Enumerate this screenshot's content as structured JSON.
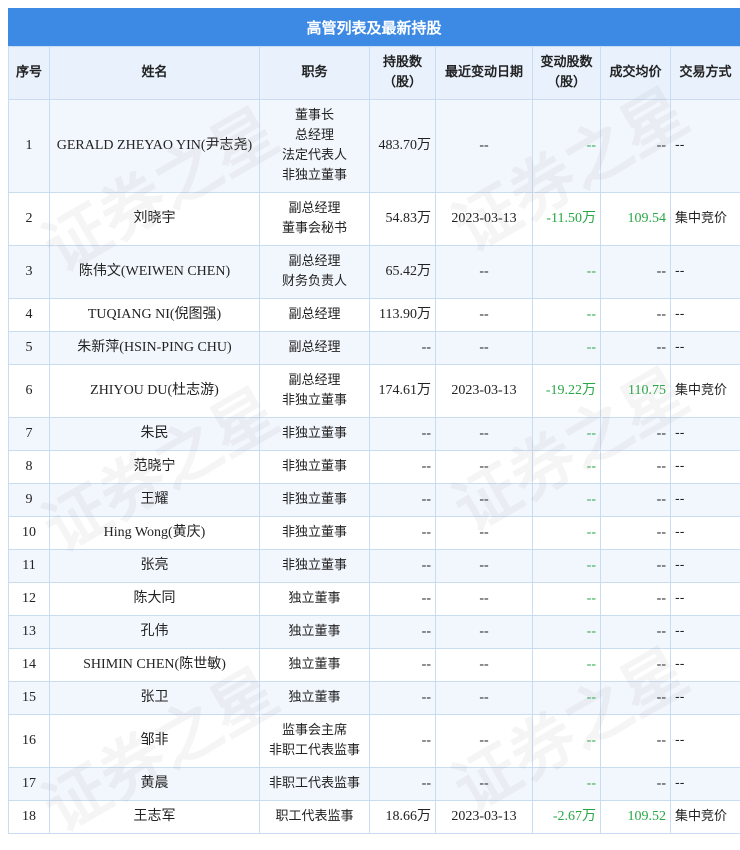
{
  "title": "高管列表及最新持股",
  "headers": {
    "idx": "序号",
    "name": "姓名",
    "position": "职务",
    "shares": "持股数（股）",
    "date": "最近变动日期",
    "change": "变动股数（股）",
    "price": "成交均价",
    "method": "交易方式"
  },
  "watermark": "证券之星",
  "rows": [
    {
      "idx": "1",
      "name": "GERALD ZHEYAO YIN(尹志尧)",
      "positions": [
        "董事长",
        "总经理",
        "法定代表人",
        "非独立董事"
      ],
      "shares": "483.70万",
      "date": "--",
      "change": "--",
      "price": "--",
      "method": "--"
    },
    {
      "idx": "2",
      "name": "刘晓宇",
      "positions": [
        "副总经理",
        "董事会秘书"
      ],
      "shares": "54.83万",
      "date": "2023-03-13",
      "change": "-11.50万",
      "price": "109.54",
      "method": "集中竞价"
    },
    {
      "idx": "3",
      "name": "陈伟文(WEIWEN CHEN)",
      "positions": [
        "副总经理",
        "财务负责人"
      ],
      "shares": "65.42万",
      "date": "--",
      "change": "--",
      "price": "--",
      "method": "--"
    },
    {
      "idx": "4",
      "name": "TUQIANG NI(倪图强)",
      "positions": [
        "副总经理"
      ],
      "shares": "113.90万",
      "date": "--",
      "change": "--",
      "price": "--",
      "method": "--"
    },
    {
      "idx": "5",
      "name": "朱新萍(HSIN-PING CHU)",
      "positions": [
        "副总经理"
      ],
      "shares": "--",
      "date": "--",
      "change": "--",
      "price": "--",
      "method": "--"
    },
    {
      "idx": "6",
      "name": "ZHIYOU DU(杜志游)",
      "positions": [
        "副总经理",
        "非独立董事"
      ],
      "shares": "174.61万",
      "date": "2023-03-13",
      "change": "-19.22万",
      "price": "110.75",
      "method": "集中竞价"
    },
    {
      "idx": "7",
      "name": "朱民",
      "positions": [
        "非独立董事"
      ],
      "shares": "--",
      "date": "--",
      "change": "--",
      "price": "--",
      "method": "--"
    },
    {
      "idx": "8",
      "name": "范晓宁",
      "positions": [
        "非独立董事"
      ],
      "shares": "--",
      "date": "--",
      "change": "--",
      "price": "--",
      "method": "--"
    },
    {
      "idx": "9",
      "name": "王耀",
      "positions": [
        "非独立董事"
      ],
      "shares": "--",
      "date": "--",
      "change": "--",
      "price": "--",
      "method": "--"
    },
    {
      "idx": "10",
      "name": "Hing Wong(黄庆)",
      "positions": [
        "非独立董事"
      ],
      "shares": "--",
      "date": "--",
      "change": "--",
      "price": "--",
      "method": "--"
    },
    {
      "idx": "11",
      "name": "张亮",
      "positions": [
        "非独立董事"
      ],
      "shares": "--",
      "date": "--",
      "change": "--",
      "price": "--",
      "method": "--"
    },
    {
      "idx": "12",
      "name": "陈大同",
      "positions": [
        "独立董事"
      ],
      "shares": "--",
      "date": "--",
      "change": "--",
      "price": "--",
      "method": "--"
    },
    {
      "idx": "13",
      "name": "孔伟",
      "positions": [
        "独立董事"
      ],
      "shares": "--",
      "date": "--",
      "change": "--",
      "price": "--",
      "method": "--"
    },
    {
      "idx": "14",
      "name": "SHIMIN CHEN(陈世敏)",
      "positions": [
        "独立董事"
      ],
      "shares": "--",
      "date": "--",
      "change": "--",
      "price": "--",
      "method": "--"
    },
    {
      "idx": "15",
      "name": "张卫",
      "positions": [
        "独立董事"
      ],
      "shares": "--",
      "date": "--",
      "change": "--",
      "price": "--",
      "method": "--"
    },
    {
      "idx": "16",
      "name": "邹非",
      "positions": [
        "监事会主席",
        "非职工代表监事"
      ],
      "shares": "--",
      "date": "--",
      "change": "--",
      "price": "--",
      "method": "--"
    },
    {
      "idx": "17",
      "name": "黄晨",
      "positions": [
        "非职工代表监事"
      ],
      "shares": "--",
      "date": "--",
      "change": "--",
      "price": "--",
      "method": "--"
    },
    {
      "idx": "18",
      "name": "王志军",
      "positions": [
        "职工代表监事"
      ],
      "shares": "18.66万",
      "date": "2023-03-13",
      "change": "-2.67万",
      "price": "109.52",
      "method": "集中竞价"
    }
  ]
}
